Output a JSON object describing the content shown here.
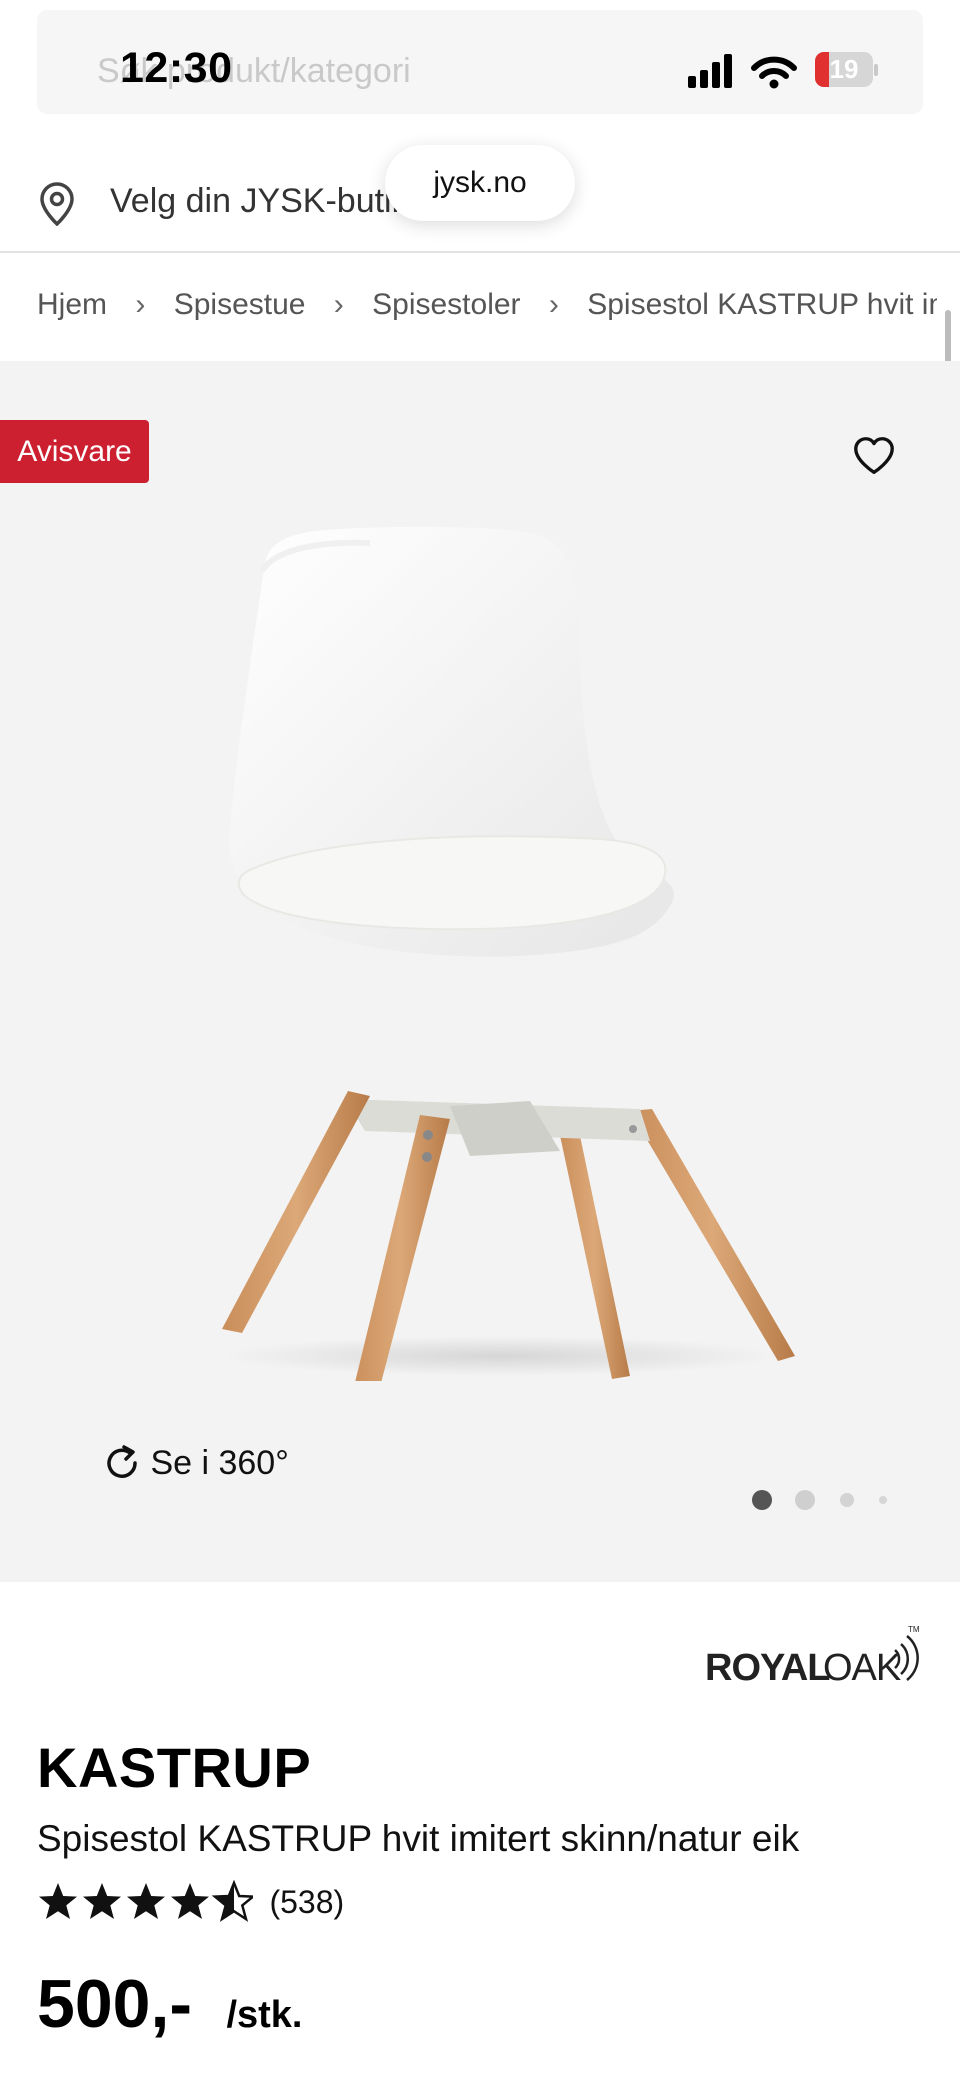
{
  "status_bar": {
    "time": "12:30",
    "battery_level": "19",
    "battery_color": "#e03030"
  },
  "search": {
    "placeholder": "Søk produkt/kategori",
    "icon": "search-icon"
  },
  "store": {
    "label": "Velg din JYSK-butikk",
    "icon": "map-pin-icon"
  },
  "browser": {
    "url": "jysk.no"
  },
  "breadcrumb": {
    "items": [
      "Hjem",
      "Spisestue",
      "Spisestoler",
      "Spisestol KASTRUP hvit imitert skinn/natur eik"
    ],
    "separator": "›"
  },
  "gallery": {
    "badge": "Avisvare",
    "badge_color": "#cc1f30",
    "favorite_icon": "heart-icon",
    "view_360_label": "Se i 360°",
    "view_360_icon": "rotate-icon",
    "image_count": 4,
    "active_image": 1
  },
  "product": {
    "brand": "ROYAL OAK",
    "name": "KASTRUP",
    "description": "Spisestol KASTRUP hvit imitert skinn/natur eik",
    "rating": 4.5,
    "review_count": "(538)",
    "price": "500,-",
    "price_unit": "/stk."
  }
}
